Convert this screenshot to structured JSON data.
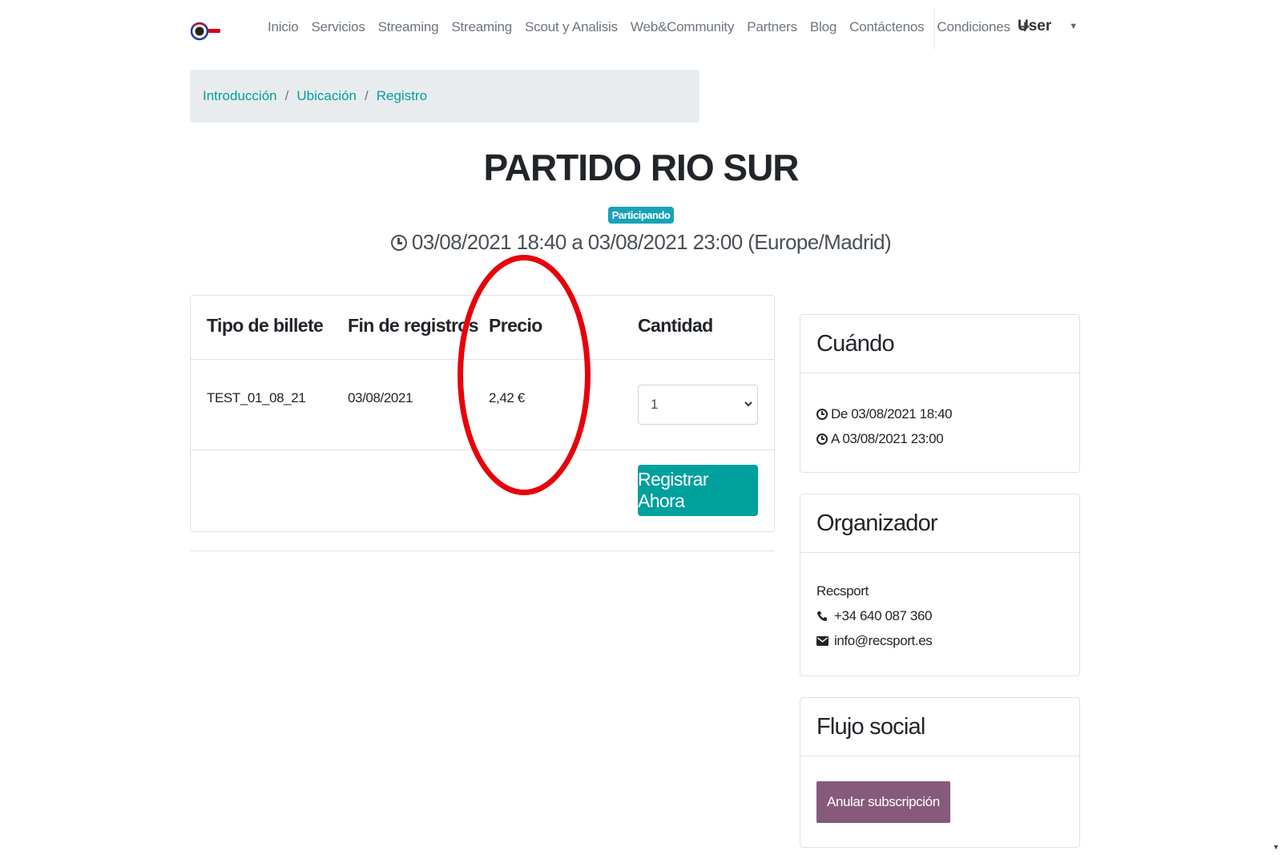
{
  "nav": {
    "links": [
      "Inicio",
      "Servicios",
      "Streaming",
      "Streaming",
      "Scout y Analisis",
      "Web&Community",
      "Partners",
      "Blog",
      "Contáctenos",
      "Condiciones"
    ],
    "user": "User"
  },
  "breadcrumb": [
    "Introducción",
    "Ubicación",
    "Registro"
  ],
  "event": {
    "title": "PARTIDO RIO SUR",
    "badge": "Participando",
    "dates": "03/08/2021 18:40 a 03/08/2021 23:00 (Europe/Madrid)"
  },
  "tickets": {
    "headers": [
      "Tipo de billete",
      "Fin de registros",
      "Precio",
      "Cantidad"
    ],
    "rows": [
      {
        "type": "TEST_01_08_21",
        "end": "03/08/2021",
        "price": "2,42 €",
        "quantity": "1"
      }
    ],
    "register_label": "Registrar Ahora"
  },
  "when": {
    "title": "Cuándo",
    "from": "De 03/08/2021 18:40",
    "to": "A 03/08/2021 23:00"
  },
  "organizer": {
    "title": "Organizador",
    "name": "Recsport",
    "phone": "+34 640 087 360",
    "email": "info@recsport.es"
  },
  "social": {
    "title": "Flujo social",
    "unsubscribe_label": "Anular subscripción"
  },
  "colors": {
    "accent": "#00a09d",
    "badge": "#17a2b8",
    "unsubscribe": "#875a7b",
    "highlight": "#e8000b"
  }
}
